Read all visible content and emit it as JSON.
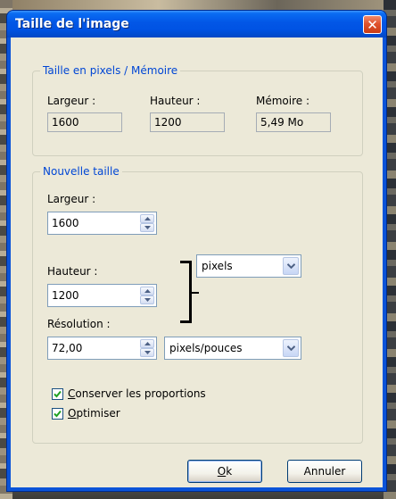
{
  "window": {
    "title": "Taille de l'image",
    "close_glyph": "✕"
  },
  "memory_group": {
    "title": "Taille en pixels / Mémoire",
    "width_label": "Largeur :",
    "height_label": "Hauteur :",
    "memory_label": "Mémoire :",
    "width_value": "1600",
    "height_value": "1200",
    "memory_value": "5,49 Mo"
  },
  "new_size_group": {
    "title": "Nouvelle taille",
    "width_label": "Largeur :",
    "width_value": "1600",
    "height_label": "Hauteur :",
    "height_value": "1200",
    "unit_selected": "pixels",
    "resolution_label": "Résolution :",
    "resolution_value": "72,00",
    "resolution_unit_selected": "pixels/pouces",
    "keep_proportions": {
      "label_first": "C",
      "label_rest": "onserver les proportions",
      "checked": true
    },
    "optimize": {
      "label_first": "O",
      "label_rest": "ptimiser",
      "checked": true
    }
  },
  "buttons": {
    "ok_first": "O",
    "ok_rest": "k",
    "cancel": "Annuler"
  },
  "colors": {
    "titlebar": "#0053e3",
    "group_title": "#0046d5",
    "client_bg": "#ece9d8",
    "close_button": "#e0532e"
  }
}
